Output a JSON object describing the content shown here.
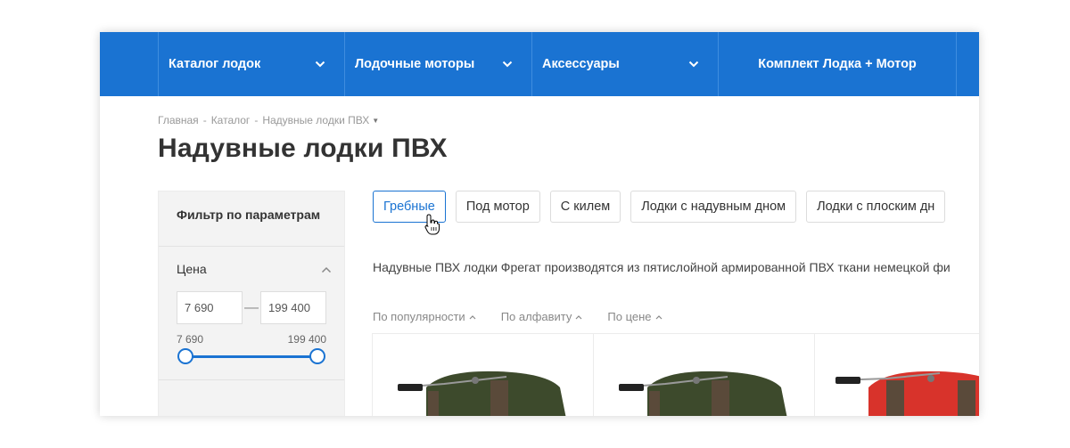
{
  "nav": {
    "items": [
      {
        "label": "Каталог лодок",
        "has_dropdown": true
      },
      {
        "label": "Лодочные моторы",
        "has_dropdown": true
      },
      {
        "label": "Аксессуары",
        "has_dropdown": true
      },
      {
        "label": "Комплект Лодка + Мотор",
        "has_dropdown": false
      }
    ]
  },
  "breadcrumb": {
    "items": [
      "Главная",
      "Каталог",
      "Надувные лодки ПВХ"
    ],
    "separator": "-"
  },
  "page_title": "Надувные лодки ПВХ",
  "filter": {
    "title": "Фильтр по параметрам",
    "price": {
      "label": "Цена",
      "min_value": "7 690",
      "max_value": "199 400",
      "range_min_label": "7 690",
      "range_max_label": "199 400",
      "dash": "—"
    }
  },
  "categories": [
    {
      "label": "Гребные",
      "active": true
    },
    {
      "label": "Под мотор",
      "active": false
    },
    {
      "label": "С килем",
      "active": false
    },
    {
      "label": "Лодки с надувным дном",
      "active": false
    },
    {
      "label": "Лодки с плоским дн",
      "active": false
    }
  ],
  "description": "Надувные ПВХ лодки Фрегат производятся из пятислойной армированной ПВХ ткани немецкой фи",
  "sort": {
    "items": [
      "По популярности",
      "По алфавиту",
      "По цене"
    ]
  },
  "products": [
    {
      "color": "#3d4a2c"
    },
    {
      "color": "#3d4a2c"
    },
    {
      "color": "#d8332b"
    }
  ],
  "colors": {
    "nav_bg": "#1a73d2",
    "accent": "#1a73d2"
  }
}
